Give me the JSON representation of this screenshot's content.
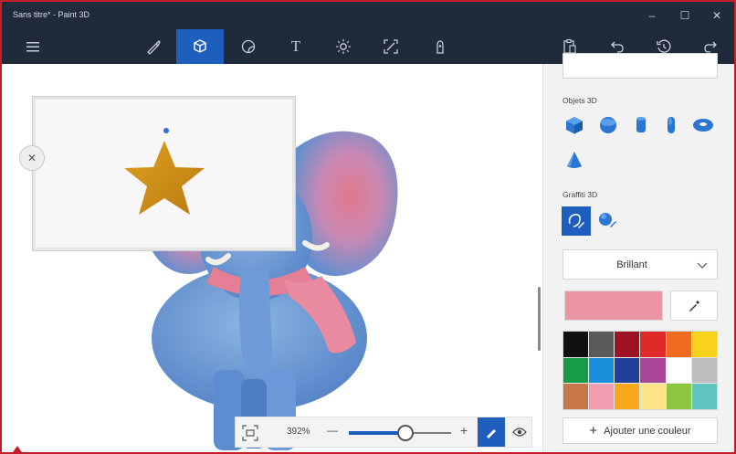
{
  "window": {
    "title": "Sans titre* - Paint 3D",
    "controls": [
      "–",
      "☐",
      "✕"
    ]
  },
  "toolbar": {
    "items": [
      {
        "icon": "menu-icon"
      },
      {
        "icon": "brushes-icon"
      },
      {
        "icon": "3d-shapes-icon",
        "active": true
      },
      {
        "icon": "stickers-icon"
      },
      {
        "icon": "text-icon",
        "glyph": "T"
      },
      {
        "icon": "effects-icon"
      },
      {
        "icon": "canvas-icon"
      },
      {
        "icon": "3d-library-icon"
      },
      {
        "icon": "paste-icon"
      },
      {
        "icon": "undo-icon"
      },
      {
        "icon": "history-icon"
      },
      {
        "icon": "redo-icon"
      }
    ],
    "accent_color": "#1e5fbd",
    "bar_color": "#1f2b3b"
  },
  "popup": {
    "close_glyph": "✕",
    "sticker": "star",
    "star_color": "#d49415"
  },
  "zoom": {
    "value": "392%",
    "minus": "—",
    "plus": "+",
    "slider_level": 0.55
  },
  "side_panel": {
    "objects_label": "Objets 3D",
    "objects": [
      "cube-icon",
      "sphere-icon",
      "cylinder-icon",
      "capsule-icon",
      "torus-icon",
      "cone-icon"
    ],
    "graffiti_label": "Graffiti 3D",
    "graffiti": [
      "sharp-edge-doodle-icon",
      "soft-edge-doodle-icon"
    ],
    "finish_dropdown": "Brillant",
    "current_color": "#ea94a4",
    "palette": [
      "#111111",
      "#5a5a5a",
      "#9c1424",
      "#e02a27",
      "#f06b22",
      "#f8d21b",
      "#169b47",
      "#1a8fdc",
      "#233f9c",
      "#a94798",
      "#ffffff",
      "#bdbdbd",
      "#c77846",
      "#ee9eae",
      "#f7a81d",
      "#fbe387",
      "#8cc63e",
      "#5fc7bf"
    ],
    "add_color_label": "Ajouter une couleur",
    "add_glyph": "+"
  }
}
